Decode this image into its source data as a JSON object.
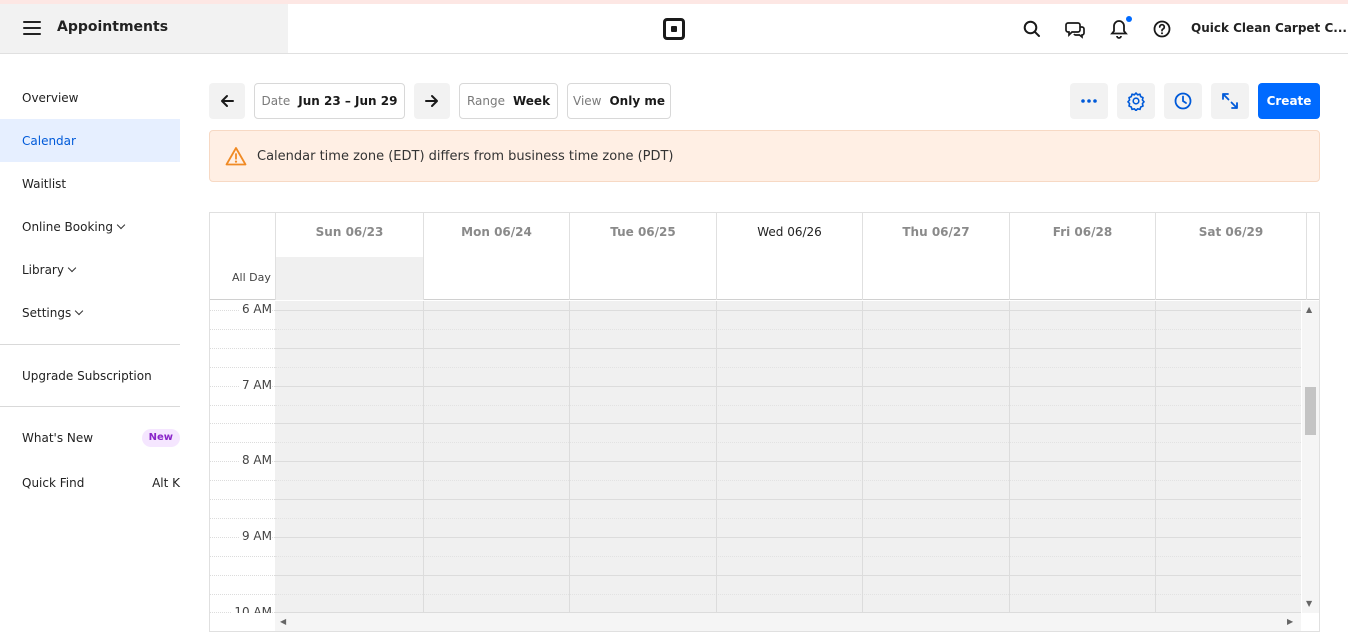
{
  "header": {
    "app_title": "Appointments",
    "business_name": "Quick Clean Carpet C...",
    "icons": [
      "menu-icon",
      "square-logo-icon",
      "search-icon",
      "messages-icon",
      "bell-icon",
      "help-icon"
    ],
    "notification_dot_color": "#006aff"
  },
  "sidebar": {
    "items": [
      {
        "label": "Overview"
      },
      {
        "label": "Calendar"
      },
      {
        "label": "Waitlist"
      },
      {
        "label": "Online Booking"
      },
      {
        "label": "Library"
      },
      {
        "label": "Settings"
      }
    ],
    "upgrade": "Upgrade Subscription",
    "whats_new": "What's New",
    "new_badge": "New",
    "quick_find": "Quick Find",
    "quick_find_shortcut": "Alt K"
  },
  "toolbar": {
    "date_label": "Date",
    "date_value": "Jun 23 – Jun 29",
    "range_label": "Range",
    "range_value": "Week",
    "view_label": "View",
    "view_value": "Only me",
    "create_label": "Create"
  },
  "alert": {
    "text": "Calendar time zone (EDT) differs from business time zone (PDT)"
  },
  "calendar": {
    "all_day_label": "All Day",
    "days": [
      "Sun 06/23",
      "Mon 06/24",
      "Tue 06/25",
      "Wed 06/26",
      "Thu 06/27",
      "Fri 06/28",
      "Sat 06/29"
    ],
    "today_index": 3,
    "times": [
      "6 AM",
      "7 AM",
      "8 AM",
      "9 AM",
      "10 AM"
    ]
  },
  "colors": {
    "accent": "#006aff",
    "active_nav_bg": "#e6efff",
    "alert_bg": "#ffefe4",
    "warning_icon": "#f08a24"
  }
}
